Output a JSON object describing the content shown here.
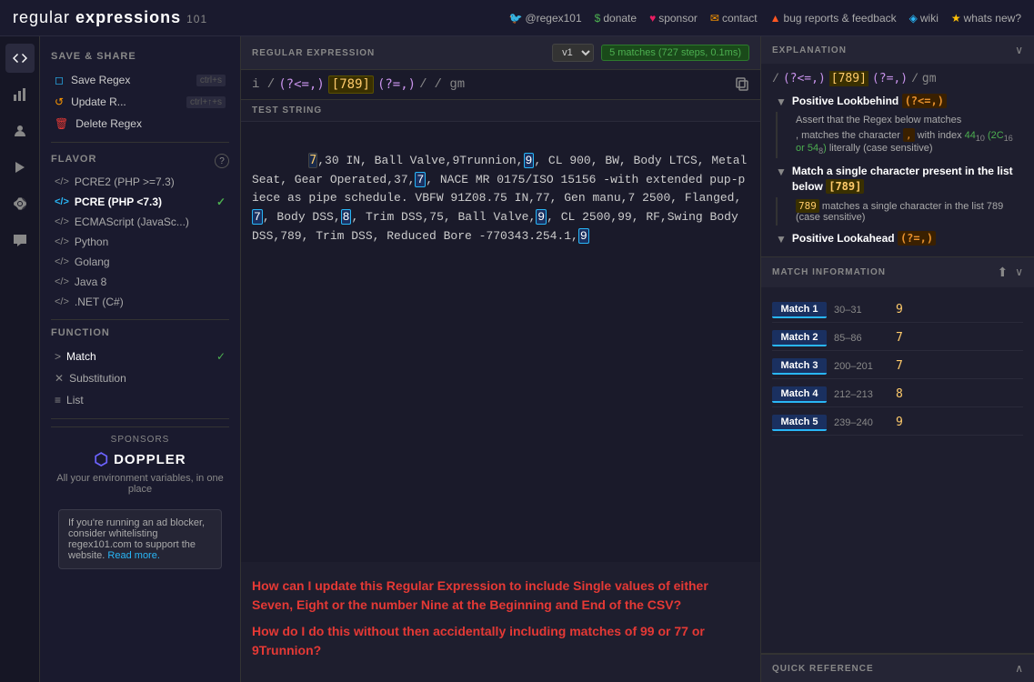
{
  "topNav": {
    "logo": "regular",
    "logoBold": "expressions",
    "logoSub": "101",
    "links": [
      {
        "icon": "twitter",
        "symbol": "🐦",
        "text": "@regex101",
        "color": "#1da1f2"
      },
      {
        "icon": "dollar",
        "symbol": "$",
        "text": "donate",
        "color": "#4caf50"
      },
      {
        "icon": "heart",
        "symbol": "♥",
        "text": "sponsor",
        "color": "#e91e63"
      },
      {
        "icon": "mail",
        "symbol": "✉",
        "text": "contact",
        "color": "#ff9800"
      },
      {
        "icon": "warning",
        "symbol": "▲",
        "text": "bug reports & feedback",
        "color": "#ff5722"
      },
      {
        "icon": "wiki",
        "symbol": "◈",
        "text": "wiki",
        "color": "#29b6f6"
      },
      {
        "icon": "new",
        "symbol": "★",
        "text": "whats new?",
        "color": "#ffc107"
      }
    ]
  },
  "sidebar": {
    "saveShare": "SAVE & SHARE",
    "saveRegex": "Save Regex",
    "saveShortcut": "ctrl+s",
    "updateRegex": "Update R...",
    "updateShortcut": "ctrl+↑+s",
    "deleteRegex": "Delete Regex",
    "flavor": "FLAVOR",
    "flavors": [
      {
        "name": "PCRE2 (PHP >=7.3)",
        "active": false
      },
      {
        "name": "PCRE (PHP <7.3)",
        "active": true
      },
      {
        "name": "ECMAScript (JavaSc...)",
        "active": false
      },
      {
        "name": "Python",
        "active": false
      },
      {
        "name": "Golang",
        "active": false
      },
      {
        "name": "Java 8",
        "active": false
      },
      {
        ".NET (C#)": ".NET (C#)",
        "active": false,
        "name": ".NET (C#)"
      }
    ],
    "function": "FUNCTION",
    "functions": [
      {
        "name": "Match",
        "active": true
      },
      {
        "name": "Substitution",
        "active": false
      },
      {
        "name": "List",
        "active": false
      }
    ],
    "sponsors": "SPONSORS",
    "dopplerName": "DOPPLER",
    "dopplerDesc": "All your environment variables, in one place",
    "adNotice": "If you're running an ad blocker, consider whitelisting regex101.com to support the website.",
    "adLink": "Read more."
  },
  "regexBar": {
    "label": "REGULAR EXPRESSION",
    "version": "v1",
    "matchBadge": "5 matches (727 steps, 0.1ms)",
    "pattern": "(?<=,)[789](?=,)",
    "patternParts": {
      "lookbehind": "(?<=,)",
      "bracket": "[789]",
      "lookahead": "(?=,)"
    },
    "flags": "gm",
    "delimiter": "/"
  },
  "testString": {
    "label": "TEST STRING",
    "content": "7,30 IN, Ball Valve,9Trunnion,9, CL 900, BW, Body LTCS, Metal Seat, Gear Operated,37,7, NACE MR 0175/ISO 15156 -with extended pup-piece as pipe schedule. VBFW 91Z08.75 IN,77, Gen manu,7 2500, Flanged,7, Body DSS,8, Trim DSS,75, Ball Valve,9, CL 2500,99, RF,Swing Body DSS,789, Trim DSS, Reduced Bore -770343.254.1,9"
  },
  "userQuestion": {
    "question1": "How can I update this Regular Expression to include Single values of either Seven, Eight or the number Nine at the Beginning and End of the CSV?",
    "question2": "How do I do this without then accidentally including matches of 99 or 77 or 9Trunnion?"
  },
  "explanation": {
    "label": "EXPLANATION",
    "regexDisplay": "/ (?<=,)[789](?=,) / gm",
    "items": [
      {
        "type": "lookbehind",
        "title": "Positive Lookbehind",
        "titleToken": "(?<=,)",
        "children": [
          {
            "desc": "Assert that the Regex below matches",
            "subDesc": ", matches the character , with index 44",
            "subDescSup1": "10",
            "subDescSup1b": "16",
            "subDescSup2": "54",
            "subDescSup2b": "8",
            "subDescEnd": "literally (case sensitive)"
          }
        ]
      },
      {
        "type": "charclass",
        "title": "Match a single character present in the list below",
        "titleToken": "[789]",
        "children": [
          {
            "desc": "789 matches a single character in the list 789 (case sensitive)"
          }
        ]
      },
      {
        "type": "lookahead",
        "title": "Positive Lookahead",
        "titleToken": "(?=,)"
      }
    ]
  },
  "matchInfo": {
    "label": "MATCH INFORMATION",
    "matches": [
      {
        "label": "Match 1",
        "range": "30–31",
        "value": "9"
      },
      {
        "label": "Match 2",
        "range": "85–86",
        "value": "7"
      },
      {
        "label": "Match 3",
        "range": "200–201",
        "value": "7"
      },
      {
        "label": "Match 4",
        "range": "212–213",
        "value": "8"
      },
      {
        "label": "Match 5",
        "range": "239–240",
        "value": "9"
      }
    ]
  },
  "quickRef": {
    "label": "QUICK REFERENCE"
  }
}
